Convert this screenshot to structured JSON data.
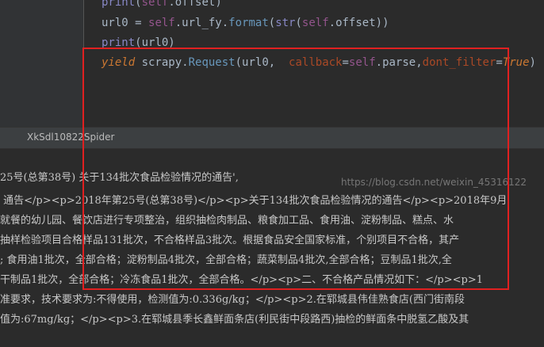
{
  "editor": {
    "lines": [
      {
        "parts": [
          [
            "k-builtin",
            "print"
          ],
          [
            "k-fn",
            "("
          ],
          [
            "k-self",
            "self"
          ],
          [
            "k-fn",
            ".offset)"
          ]
        ]
      },
      {
        "parts": [
          [
            "k-fn",
            "url0 = "
          ],
          [
            "k-self",
            "self"
          ],
          [
            "k-fn",
            ".url_fy."
          ],
          [
            "k-blue",
            "format"
          ],
          [
            "k-fn",
            "("
          ],
          [
            "k-builtin",
            "str"
          ],
          [
            "k-fn",
            "("
          ],
          [
            "k-self",
            "self"
          ],
          [
            "k-fn",
            ".offset))"
          ]
        ]
      },
      {
        "parts": [
          [
            "k-builtin",
            "print"
          ],
          [
            "k-fn",
            "(url0)"
          ]
        ]
      },
      {
        "parts": [
          [
            "k-yield",
            "yield "
          ],
          [
            "k-fn",
            "scrapy."
          ],
          [
            "k-blue",
            "Request"
          ],
          [
            "k-fn",
            "(url0,  "
          ],
          [
            "k-param",
            "callback"
          ],
          [
            "k-fn",
            "="
          ],
          [
            "k-self",
            "self"
          ],
          [
            "k-fn",
            ".parse,"
          ],
          [
            "k-param",
            "dont_filter"
          ],
          [
            "k-fn",
            "="
          ],
          [
            "k-true",
            "True"
          ],
          [
            "k-fn",
            ")"
          ]
        ]
      }
    ]
  },
  "tab": {
    "label": "XkSdl10822Spider"
  },
  "console": {
    "lines": [
      "25号(总第38号) 关于134批次食品检验情况的通告',",
      " 通告</p><p>2018年第25号(总第38号)</p><p>关于134批次食品检验情况的通告</p><p>2018年9月",
      "就餐的幼儿园、餐饮店进行专项整治，组织抽检肉制品、粮食加工品、食用油、淀粉制品、糕点、水",
      "抽样检验项目合格样品131批次，不合格样品3批次。根据食品安全国家标准，个别项目不合格，其产",
      "; 食用油1批次，全部合格；淀粉制品4批次，全部合格；蔬菜制品4批次,全部合格；豆制品1批次,全",
      "干制品1批次，全部合格；冷冻食品1批次，全部合格。</p><p>二、不合格产品情况如下：</p><p>1",
      "准要求，技术要求为:不得使用，检测值为:0.336g/kg；</p><p>2.在郓城县伟佳熟食店(西门街南段",
      "值为:67mg/kg；</p><p>3.在郓城县季长鑫鲜面条店(利民街中段路西)抽检的鲜面条中脱氢乙酸及其"
    ]
  },
  "watermark": "https://blog.csdn.net/weixin_45316122"
}
